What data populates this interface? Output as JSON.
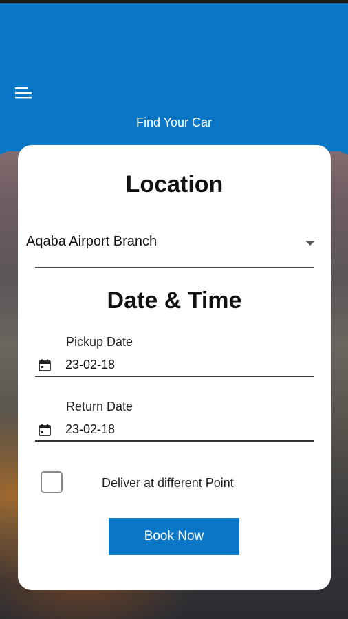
{
  "header": {
    "title": "Find Your Car",
    "menu_icon": "hamburger-menu-icon",
    "background_color": "#0a76c6"
  },
  "form": {
    "location_heading": "Location",
    "location_value": "Aqaba Airport Branch",
    "location_dropdown_icon": "dropdown-arrow-icon",
    "datetime_heading": "Date & Time",
    "pickup": {
      "label": "Pickup Date",
      "value": "23-02-18",
      "icon": "calendar-icon"
    },
    "return": {
      "label": "Return Date",
      "value": "23-02-18",
      "icon": "calendar-icon"
    },
    "deliver_checkbox": {
      "label": "Deliver at different Point",
      "checked": false
    },
    "submit_label": "Book Now",
    "accent_color": "#0a76c6"
  }
}
